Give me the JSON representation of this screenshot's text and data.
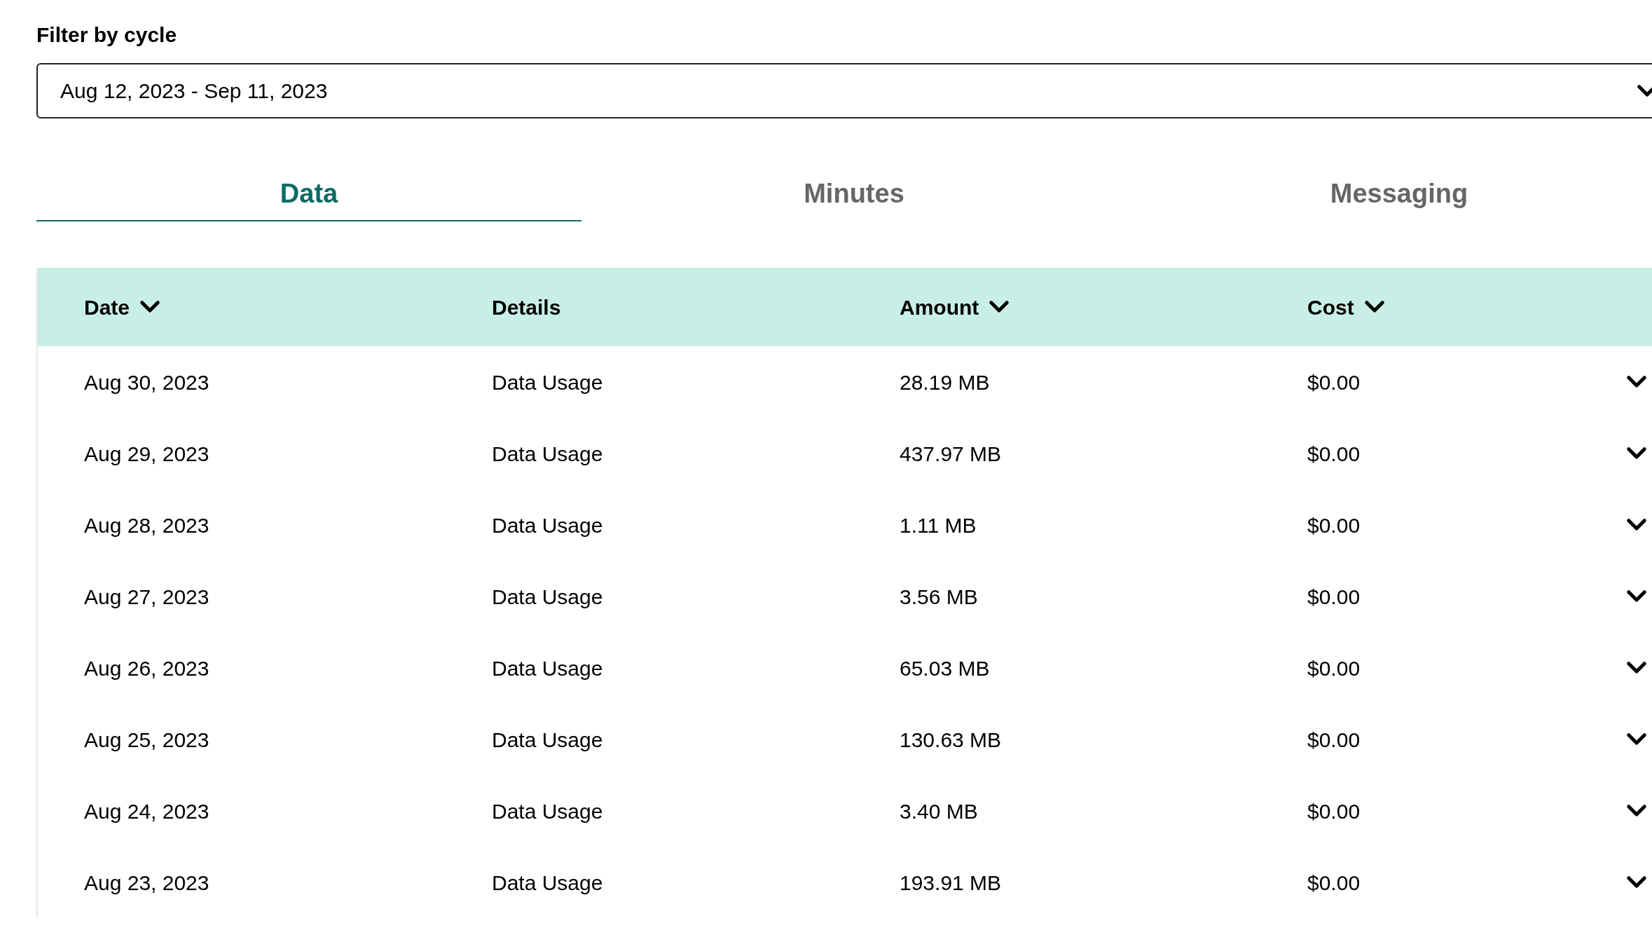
{
  "filter": {
    "label": "Filter by cycle",
    "value": "Aug 12, 2023 - Sep 11, 2023"
  },
  "tabs": [
    {
      "label": "Data",
      "selected": true
    },
    {
      "label": "Minutes",
      "selected": false
    },
    {
      "label": "Messaging",
      "selected": false
    }
  ],
  "table": {
    "columns": [
      {
        "label": "Date",
        "sortable": true
      },
      {
        "label": "Details",
        "sortable": false
      },
      {
        "label": "Amount",
        "sortable": true
      },
      {
        "label": "Cost",
        "sortable": true
      }
    ],
    "rows": [
      [
        "Aug 30, 2023",
        "Data Usage",
        "28.19 MB",
        "$0.00"
      ],
      [
        "Aug 29, 2023",
        "Data Usage",
        "437.97 MB",
        "$0.00"
      ],
      [
        "Aug 28, 2023",
        "Data Usage",
        "1.11 MB",
        "$0.00"
      ],
      [
        "Aug 27, 2023",
        "Data Usage",
        "3.56 MB",
        "$0.00"
      ],
      [
        "Aug 26, 2023",
        "Data Usage",
        "65.03 MB",
        "$0.00"
      ],
      [
        "Aug 25, 2023",
        "Data Usage",
        "130.63 MB",
        "$0.00"
      ],
      [
        "Aug 24, 2023",
        "Data Usage",
        "3.40 MB",
        "$0.00"
      ],
      [
        "Aug 23, 2023",
        "Data Usage",
        "193.91 MB",
        "$0.00"
      ]
    ]
  }
}
